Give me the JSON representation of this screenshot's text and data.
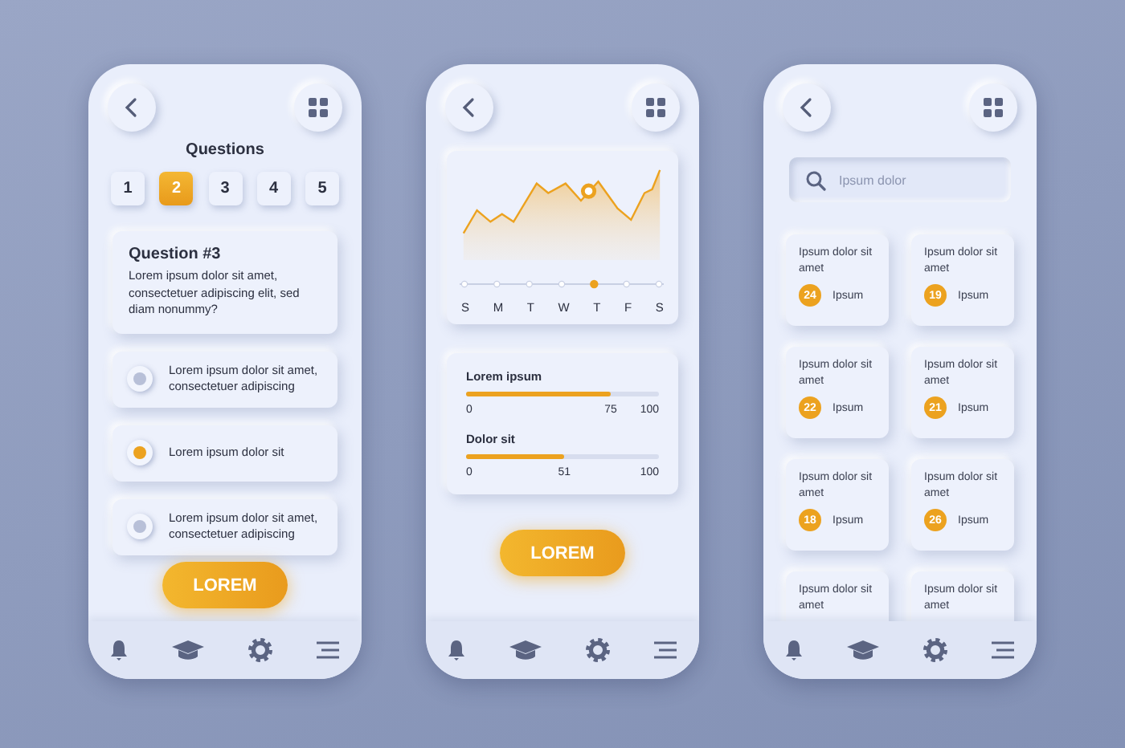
{
  "screens": [
    {
      "kind": "quiz",
      "title": "Questions",
      "steps": [
        {
          "label": "1",
          "selected": false
        },
        {
          "label": "2",
          "selected": true
        },
        {
          "label": "3",
          "selected": false
        },
        {
          "label": "4",
          "selected": false
        },
        {
          "label": "5",
          "selected": false
        }
      ],
      "question": {
        "heading": "Question #3",
        "text": "Lorem ipsum dolor sit amet, consectetuer adipiscing elit, sed diam nonummy?"
      },
      "options": [
        {
          "text": "Lorem ipsum dolor sit amet, consectetuer adipiscing",
          "selected": false
        },
        {
          "text": "Lorem ipsum dolor sit",
          "selected": true
        },
        {
          "text": "Lorem ipsum dolor sit amet, consectetuer adipiscing",
          "selected": false
        }
      ],
      "button": "LOREM"
    },
    {
      "kind": "stats",
      "days": [
        {
          "label": "S",
          "selected": false
        },
        {
          "label": "M",
          "selected": false
        },
        {
          "label": "T",
          "selected": false
        },
        {
          "label": "W",
          "selected": false
        },
        {
          "label": "T",
          "selected": true
        },
        {
          "label": "F",
          "selected": false
        },
        {
          "label": "S",
          "selected": false
        }
      ],
      "sliders": [
        {
          "label": "Lorem ipsum",
          "level": 0.75,
          "min": "0",
          "value": "75",
          "max": "100"
        },
        {
          "label": "Dolor sit",
          "level": 0.51,
          "min": "0",
          "value": "51",
          "max": "100"
        }
      ],
      "button": "LOREM"
    },
    {
      "kind": "list",
      "search": {
        "placeholder": "Ipsum dolor"
      },
      "cards": [
        {
          "title": "Ipsum dolor sit amet",
          "count": "24",
          "label": "Ipsum"
        },
        {
          "title": "Ipsum dolor sit amet",
          "count": "19",
          "label": "Ipsum"
        },
        {
          "title": "Ipsum dolor sit amet",
          "count": "22",
          "label": "Ipsum"
        },
        {
          "title": "Ipsum dolor sit amet",
          "count": "21",
          "label": "Ipsum"
        },
        {
          "title": "Ipsum dolor sit amet",
          "count": "18",
          "label": "Ipsum"
        },
        {
          "title": "Ipsum dolor sit amet",
          "count": "26",
          "label": "Ipsum"
        },
        {
          "title": "Ipsum dolor sit amet"
        },
        {
          "title": "Ipsum dolor sit amet"
        }
      ]
    }
  ]
}
